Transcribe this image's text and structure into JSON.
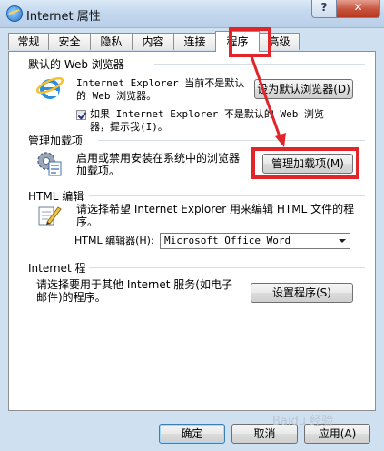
{
  "window": {
    "title": "Internet 属性",
    "help_glyph": "?",
    "close_glyph": "✕"
  },
  "tabs": [
    {
      "label": "常规"
    },
    {
      "label": "安全"
    },
    {
      "label": "隐私"
    },
    {
      "label": "内容"
    },
    {
      "label": "连接"
    },
    {
      "label": "程序",
      "active": true
    },
    {
      "label": "高级"
    }
  ],
  "default_browser": {
    "title": "默认的 Web 浏览器",
    "status_text": "Internet Explorer 当前不是默认的 Web 浏览器。",
    "set_default_button": "设为默认浏览器(D)",
    "check_text": "如果 Internet Explorer 不是默认的 Web 浏览器，提示我(I)。",
    "checked": true
  },
  "addons": {
    "title": "管理加载项",
    "description": "启用或禁用安装在系统中的浏览器加载项。",
    "manage_button": "管理加载项(M)"
  },
  "html_editing": {
    "title": "HTML 编辑",
    "description": "请选择希望 Internet Explorer 用来编辑 HTML 文件的程序。",
    "editor_label": "HTML 编辑器(H):",
    "editor_value": "Microsoft Office Word"
  },
  "internet_programs": {
    "title": "Internet 程",
    "description": "请选择要用于其他 Internet 服务(如电子邮件)的程序。",
    "set_programs_button": "设置程序(S)"
  },
  "footer": {
    "ok": "确定",
    "cancel": "取消",
    "apply": "应用(A)"
  },
  "watermark": "Baidu 经验",
  "colors": {
    "annotation": "#e1262b",
    "titlebar": "#c4d8ee",
    "panel_bg": "#ffffff"
  }
}
